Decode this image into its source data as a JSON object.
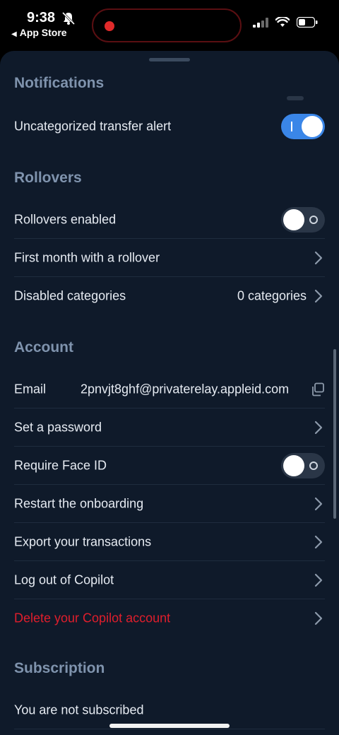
{
  "status_bar": {
    "time": "9:38",
    "back_app": "App Store"
  },
  "sections": {
    "notifications": {
      "title": "Notifications"
    },
    "rollovers": {
      "title": "Rollovers"
    },
    "account": {
      "title": "Account"
    },
    "subscription": {
      "title": "Subscription"
    }
  },
  "rows": {
    "uncategorized_alert": {
      "label": "Uncategorized transfer alert",
      "enabled": true
    },
    "rollovers_enabled": {
      "label": "Rollovers enabled",
      "enabled": false
    },
    "first_month": {
      "label": "First month with a rollover"
    },
    "disabled_categories": {
      "label": "Disabled categories",
      "value": "0 categories"
    },
    "email": {
      "label": "Email",
      "value": "2pnvjt8ghf@privaterelay.appleid.com"
    },
    "set_password": {
      "label": "Set a password"
    },
    "face_id": {
      "label": "Require Face ID",
      "enabled": false
    },
    "restart_onboarding": {
      "label": "Restart the onboarding"
    },
    "export_transactions": {
      "label": "Export your transactions"
    },
    "log_out": {
      "label": "Log out of Copilot"
    },
    "delete_account": {
      "label": "Delete your Copilot account"
    },
    "subscription_status": {
      "label": "You are not subscribed"
    }
  },
  "colors": {
    "background": "#0f1a2a",
    "section_title": "#7f93ad",
    "accent_toggle": "#3a86e8",
    "danger": "#e01e2c"
  }
}
